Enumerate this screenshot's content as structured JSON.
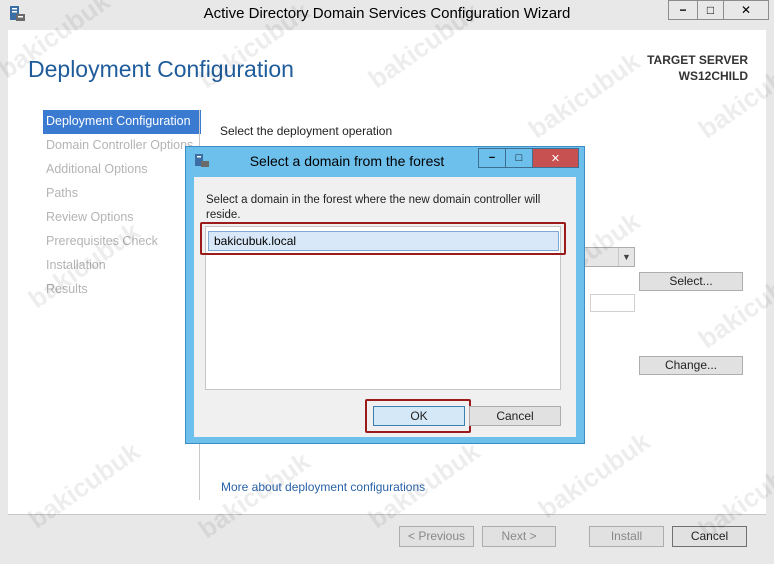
{
  "window": {
    "title": "Active Directory Domain Services Configuration Wizard",
    "min_glyph": "−",
    "max_glyph": "□",
    "close_glyph": "✕"
  },
  "page": {
    "title": "Deployment Configuration",
    "target_server_label": "TARGET SERVER",
    "target_server_name": "WS12CHILD"
  },
  "nav": {
    "items": [
      {
        "label": "Deployment Configuration",
        "active": true
      },
      {
        "label": "Domain Controller Options",
        "active": false
      },
      {
        "label": "Additional Options",
        "active": false
      },
      {
        "label": "Paths",
        "active": false
      },
      {
        "label": "Review Options",
        "active": false
      },
      {
        "label": "Prerequisites Check",
        "active": false
      },
      {
        "label": "Installation",
        "active": false
      },
      {
        "label": "Results",
        "active": false
      }
    ]
  },
  "main": {
    "section_label": "Select the deployment operation",
    "select_button": "Select...",
    "change_button": "Change...",
    "more_link": "More about deployment configurations"
  },
  "footer": {
    "previous": "< Previous",
    "next": "Next >",
    "install": "Install",
    "cancel": "Cancel"
  },
  "dialog": {
    "title": "Select a domain from the forest",
    "instruction": "Select a domain in the forest where the new domain controller will reside.",
    "domains": [
      "bakicubuk.local"
    ],
    "ok": "OK",
    "cancel": "Cancel"
  },
  "watermark": "bakicubuk",
  "colors": {
    "accent": "#1e5c9b",
    "nav_active": "#3a7ad1",
    "dialog_frame": "#6ec0ec",
    "close_button": "#c75050",
    "highlight_box": "#9b1b1b"
  }
}
